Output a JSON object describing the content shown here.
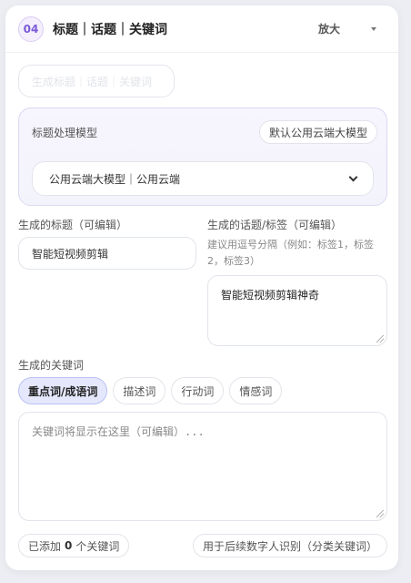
{
  "header": {
    "step": "04",
    "title": "标题｜话题｜关键词",
    "zoom_label": "放大"
  },
  "ghost_pill": "生成标题｜话题｜关键词",
  "model": {
    "label": "标题处理模型",
    "default_button": "默认公用云端大模型",
    "selected": "公用云端大模型｜公用云端"
  },
  "title_section": {
    "label": "生成的标题（可编辑）",
    "value": "智能短视频剪辑"
  },
  "topic_section": {
    "label": "生成的话题/标签（可编辑）",
    "hint": "建议用逗号分隔（例如：标签1，标签2，标签3）",
    "value": "智能短视频剪辑神奇"
  },
  "keywords": {
    "label": "生成的关键词",
    "tabs": [
      "重点词/成语词",
      "描述词",
      "行动词",
      "情感词"
    ],
    "active_tab": 0,
    "placeholder": "关键词将显示在这里（可编辑）...",
    "added_prefix": "已添加",
    "added_count": "0",
    "added_suffix": "个关键词",
    "usage_note": "用于后续数字人识别（分类关键词）"
  }
}
